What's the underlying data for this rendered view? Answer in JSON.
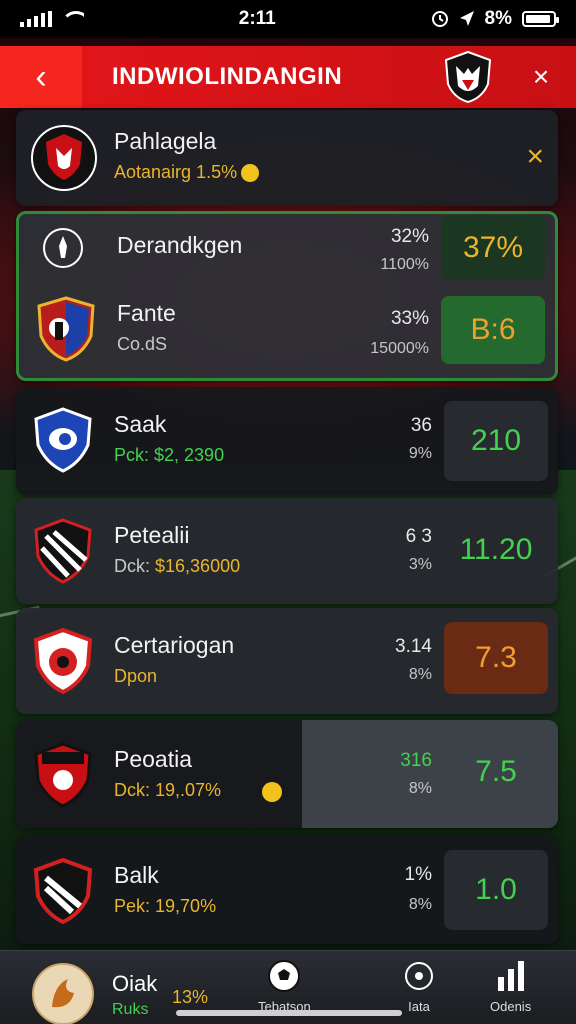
{
  "status_bar": {
    "time": "2:11",
    "battery": "8%"
  },
  "header": {
    "back_icon": "‹",
    "title": "INDWIOLINDANGIN",
    "close_icon": "×"
  },
  "top_card": {
    "name": "Pahlagela",
    "subtitle": "Aotanairg  1.5%",
    "close_icon": "×"
  },
  "group_card": {
    "row1": {
      "name": "Derandkgen",
      "pct1": "32%",
      "pct2": "1100%",
      "odds": "37%"
    },
    "row2": {
      "name": "Fante",
      "sub": "Co.dS",
      "pct1": "33%",
      "pct2": "15000%",
      "odds": "B:6"
    }
  },
  "teams": [
    {
      "name": "Saak",
      "sub": "Pck: $2, 2390",
      "pct1": "36",
      "pct2": "9%",
      "odds": "210"
    },
    {
      "name": "Petealii",
      "sub_prefix": "Dck: ",
      "sub_value": "$16,36000",
      "pct1": "6 3",
      "pct2": "3%",
      "odds": "11.20"
    },
    {
      "name": "Certariogan",
      "sub": "Dpon",
      "pct1": "3.14",
      "pct2": "8%",
      "odds": "7.3"
    },
    {
      "name": "Peoatia",
      "sub": "Dck: 19,.07%",
      "pct1": "316",
      "pct2": "8%",
      "odds": "7.5"
    },
    {
      "name": "Balk",
      "sub": "Pek: 19,70%",
      "pct1": "1%",
      "pct2": "8%",
      "odds": "1.0"
    }
  ],
  "bottom_nav": {
    "profile": {
      "name": "Oiak",
      "sub": "Ruks",
      "value": "13%"
    },
    "items": [
      {
        "label": "Tebatson"
      },
      {
        "label": "Iata"
      },
      {
        "label": "Odenis"
      }
    ]
  },
  "colors": {
    "accent_red": "#e3161a",
    "odds_green": "#43d14f",
    "gold": "#e8b52c",
    "highlight_border": "#2e8b3a"
  }
}
